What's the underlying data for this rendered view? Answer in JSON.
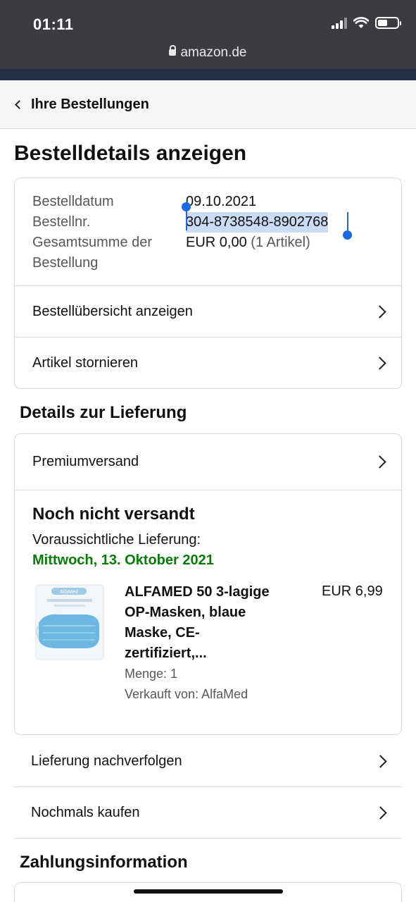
{
  "status_bar": {
    "time": "01:11",
    "battery_level": 0.5
  },
  "url_bar": {
    "domain": "amazon.de"
  },
  "back_nav": {
    "label": "Ihre Bestellungen"
  },
  "page_title": "Bestelldetails anzeigen",
  "order_info": {
    "date_label": "Bestelldatum",
    "date_value": "09.10.2021",
    "number_label": "Bestellnr.",
    "number_value": "304-8738548-8902768",
    "total_label_line1": "Gesamtsumme der",
    "total_label_line2": "Bestellung",
    "total_value": "EUR 0,00",
    "total_items": "(1 Artikel)",
    "link_overview": "Bestellübersicht anzeigen",
    "link_cancel": "Artikel stornieren"
  },
  "delivery": {
    "section_title": "Details zur Lieferung",
    "shipping_method": "Premiumversand",
    "status": "Noch nicht versandt",
    "eta_label": "Voraussichtliche Lieferung:",
    "eta_date": "Mittwoch, 13. Oktober 2021",
    "product": {
      "title_lines": [
        "ALFAMED 50 3-lagige",
        "OP-Masken, blaue",
        "Maske, CE-",
        "zertifiziert,..."
      ],
      "price": "EUR 6,99",
      "quantity": "Menge: 1",
      "seller": "Verkauft von: AlfaMed",
      "package_brand": "AlfaMed"
    },
    "track_label": "Lieferung nachverfolgen",
    "buy_again_label": "Nochmals kaufen"
  },
  "payment": {
    "section_title": "Zahlungsinformation"
  }
}
